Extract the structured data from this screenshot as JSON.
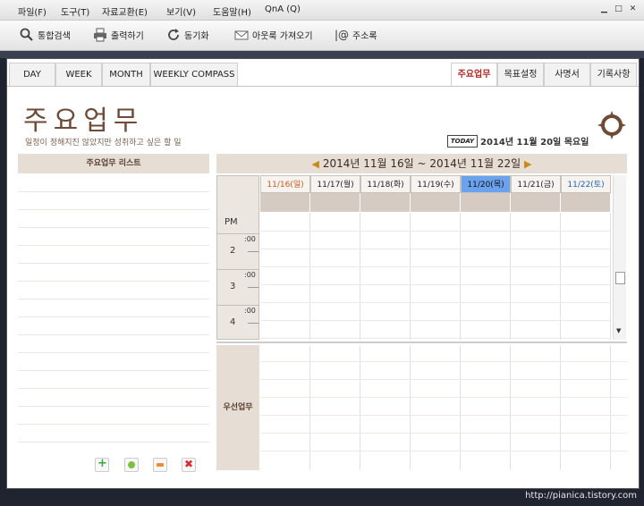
{
  "menu": [
    "파일(F)",
    "도구(T)",
    "자료교환(E)",
    "보기(V)",
    "도움말(H)",
    "QnA (Q)"
  ],
  "toolbar": {
    "search": "통합검색",
    "print": "출력하기",
    "sync": "동기화",
    "outlook": "아웃룩 가져오기",
    "address": "주소록"
  },
  "tabs_left": [
    "DAY",
    "WEEK",
    "MONTH",
    "WEEKLY COMPASS"
  ],
  "tabs_right": [
    "주요업무",
    "목표설정",
    "사명서",
    "기록사항"
  ],
  "page": {
    "title": "주요업무",
    "subtitle": "일정이 정해지진 않았지만 성취하고 싶은 할 일",
    "today_badge": "TODAY",
    "today_date": "2014년 11월 20일 목요일"
  },
  "list": {
    "header": "주요업무 리스트"
  },
  "calendar": {
    "range": "2014년 11월 16일 ~ 2014년 11월 22일",
    "prev_arrow": "◀",
    "next_arrow": "▶",
    "days": [
      "11/16(일)",
      "11/17(월)",
      "11/18(화)",
      "11/19(수)",
      "11/20(목)",
      "11/21(금)",
      "11/22(토)"
    ],
    "ampm": "PM",
    "hours": [
      "2",
      "3",
      "4"
    ],
    "minute_label": ":00",
    "priority_label": "우선업무"
  },
  "colors": {
    "accent": "#b3261e",
    "today_column": "#6aa2ee",
    "header_beige": "#e6ddd5",
    "title_brown": "#6e4a37"
  },
  "watermark": "http://pianica.tistory.com"
}
